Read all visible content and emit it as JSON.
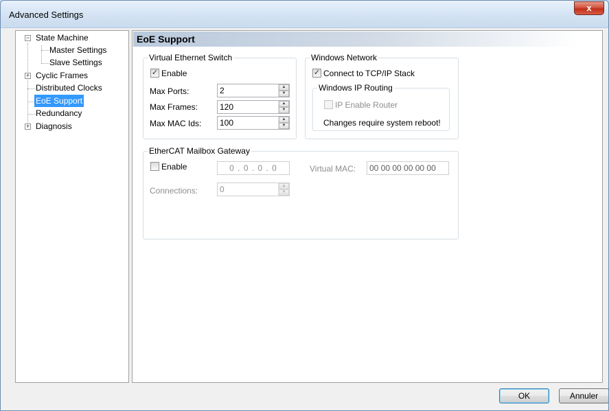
{
  "window": {
    "title": "Advanced Settings",
    "close_glyph": "x"
  },
  "tree": {
    "items": [
      {
        "label": "State Machine",
        "expander": "−"
      },
      {
        "label": "Master Settings"
      },
      {
        "label": "Slave Settings"
      },
      {
        "label": "Cyclic Frames",
        "expander": "+"
      },
      {
        "label": "Distributed Clocks"
      },
      {
        "label": "EoE Support",
        "selected": true
      },
      {
        "label": "Redundancy"
      },
      {
        "label": "Diagnosis",
        "expander": "+"
      }
    ]
  },
  "panel": {
    "title": "EoE Support",
    "vswitch": {
      "legend": "Virtual Ethernet Switch",
      "enable_label": "Enable",
      "enable_checked": true,
      "max_ports_label": "Max Ports:",
      "max_ports_value": "2",
      "max_frames_label": "Max Frames:",
      "max_frames_value": "120",
      "max_mac_label": "Max MAC Ids:",
      "max_mac_value": "100"
    },
    "winnet": {
      "legend": "Windows Network",
      "connect_label": "Connect to TCP/IP Stack",
      "connect_checked": true,
      "routing": {
        "legend": "Windows IP Routing",
        "ip_router_label": "IP Enable Router",
        "note": "Changes require system reboot!"
      }
    },
    "gateway": {
      "legend": "EtherCAT Mailbox Gateway",
      "enable_label": "Enable",
      "ip_value": "0 . 0 . 0 . 0",
      "virtual_mac_label": "Virtual MAC:",
      "virtual_mac_value": "00 00 00 00 00 00",
      "connections_label": "Connections:",
      "connections_value": "0"
    }
  },
  "buttons": {
    "ok": "OK",
    "cancel": "Annuler"
  },
  "glyphs": {
    "check": "✓",
    "spin_up": "▲",
    "spin_down": "▼"
  },
  "colors": {
    "selection": "#3399ff",
    "title_bar": "#c9dbee",
    "close_button": "#c12f1a"
  }
}
